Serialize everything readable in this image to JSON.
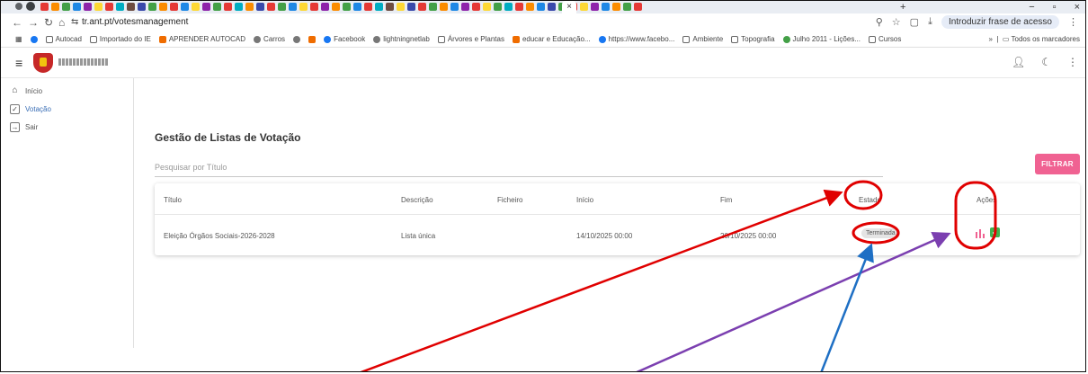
{
  "browser": {
    "url": "tr.ant.pt/votesmanagement",
    "active_tab_close": "×",
    "new_tab": "+",
    "window_controls": [
      "−",
      "▫",
      "×"
    ],
    "translate_phrase": "Introduzir frase de acesso",
    "bookmarks": [
      "Autocad",
      "Importado do IE",
      "APRENDER AUTOCAD",
      "Carros",
      "Facebook",
      "lightningnetlab",
      "Árvores e Plantas",
      "educar e Educação...",
      "https://www.facebo...",
      "Ambiente",
      "Topografia",
      "Julho 2011 - Lições...",
      "Cursos"
    ],
    "bookmarks_more": "»",
    "all_bookmarks": "Todos os marcadores"
  },
  "sidebar": {
    "items": [
      {
        "label": "Início",
        "icon": "home-icon"
      },
      {
        "label": "Votação",
        "icon": "checkbox-icon"
      },
      {
        "label": "Sair",
        "icon": "logout-icon"
      }
    ]
  },
  "main": {
    "title": "Gestão de Listas de Votação",
    "search_placeholder": "Pesquisar por Título",
    "filter_label": "FILTRAR",
    "table": {
      "headers": [
        "Título",
        "Descrição",
        "Ficheiro",
        "Início",
        "Fim",
        "Estado",
        "Ações"
      ],
      "rows": [
        {
          "titulo": "Eleição Órgãos Sociais-2026-2028",
          "descricao": "Lista única",
          "ficheiro": "",
          "inicio": "14/10/2025 00:00",
          "fim": "20/10/2025 00:00",
          "estado": "Terminada"
        }
      ]
    }
  },
  "colors": {
    "accent": "#f06292",
    "annotation_red": "#e00000",
    "annotation_purple": "#7b3fb0",
    "annotation_blue": "#1e6fc4",
    "success": "#3fb34f"
  }
}
